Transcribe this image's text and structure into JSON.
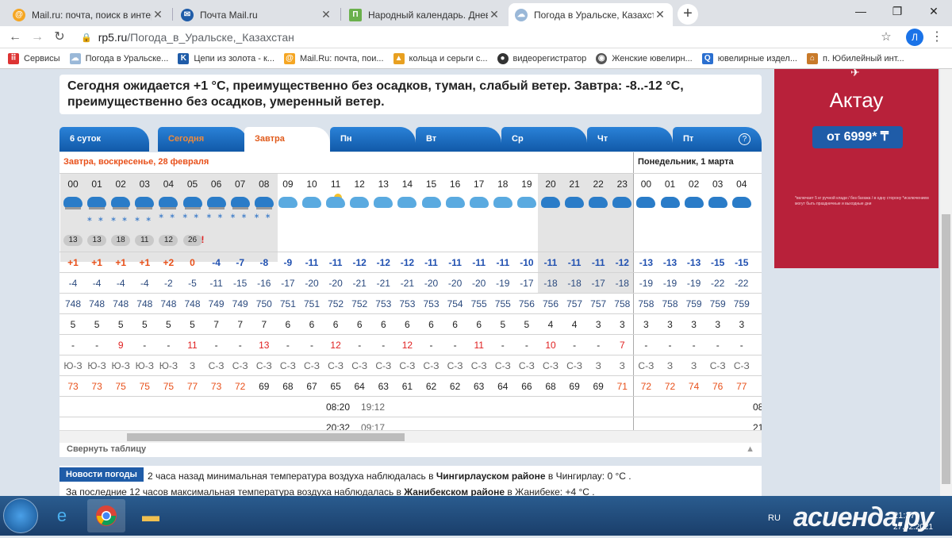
{
  "browser": {
    "tabs": [
      {
        "title": "Mail.ru: почта, поиск в интернете",
        "icon": "mail-ru-icon"
      },
      {
        "title": "Почта Mail.ru",
        "icon": "mail-icon"
      },
      {
        "title": "Народный календарь. Дневник",
        "icon": "calendar-icon"
      },
      {
        "title": "Погода в Уральске, Казахстан -",
        "icon": "weather-icon",
        "active": true
      }
    ],
    "url_host": "rp5.ru",
    "url_path": "/Погода_в_Уральске,_Казахстан",
    "profile_initial": "Л",
    "bookmarks": [
      {
        "label": "Сервисы",
        "icon": "apps-icon"
      },
      {
        "label": "Погода в Уральске...",
        "icon": "weather-icon"
      },
      {
        "label": "Цепи из золота - к...",
        "icon": "chain-icon"
      },
      {
        "label": "Mail.Ru: почта, пои...",
        "icon": "mail-ru-icon"
      },
      {
        "label": "кольца и серьги с...",
        "icon": "ring-icon"
      },
      {
        "label": "видеорегистратор",
        "icon": "camera-icon"
      },
      {
        "label": "Женские ювелирн...",
        "icon": "jewel-icon"
      },
      {
        "label": "ювелирные издел...",
        "icon": "search-icon"
      },
      {
        "label": "п. Юбилейный инт...",
        "icon": "home-icon"
      }
    ]
  },
  "forecast_text": "Сегодня ожидается +1 °C, преимущественно без осадков, туман, слабый ветер. Завтра: -8..-12 °C, преимущественно без осадков, умеренный ветер.",
  "day_tabs": [
    "6 суток",
    "Сегодня",
    "Завтра",
    "Пн",
    "Вт",
    "Ср",
    "Чт",
    "Пт"
  ],
  "help_label": "?",
  "table": {
    "day1_title": "Завтра, воскресенье, 28 февраля",
    "day2_title": "Понедельник, 1 марта",
    "hours": [
      "00",
      "01",
      "02",
      "03",
      "04",
      "05",
      "06",
      "07",
      "08",
      "09",
      "10",
      "11",
      "12",
      "13",
      "14",
      "15",
      "16",
      "17",
      "18",
      "19",
      "20",
      "21",
      "22",
      "23",
      "00",
      "01",
      "02",
      "03",
      "04"
    ],
    "visibility_pills": [
      "13",
      "13",
      "18",
      "11",
      "12",
      "26"
    ],
    "visibility_warn": "!",
    "temp": [
      "+1",
      "+1",
      "+1",
      "+1",
      "+2",
      "0",
      "-4",
      "-7",
      "-8",
      "-9",
      "-11",
      "-11",
      "-12",
      "-12",
      "-12",
      "-11",
      "-11",
      "-11",
      "-11",
      "-10",
      "-11",
      "-11",
      "-11",
      "-12",
      "-13",
      "-13",
      "-13",
      "-15",
      "-15"
    ],
    "feels": [
      "-4",
      "-4",
      "-4",
      "-4",
      "-2",
      "-5",
      "-11",
      "-15",
      "-16",
      "-17",
      "-20",
      "-20",
      "-21",
      "-21",
      "-21",
      "-20",
      "-20",
      "-20",
      "-19",
      "-17",
      "-18",
      "-18",
      "-17",
      "-18",
      "-19",
      "-19",
      "-19",
      "-22",
      "-22"
    ],
    "pressure": [
      "748",
      "748",
      "748",
      "748",
      "748",
      "748",
      "749",
      "749",
      "750",
      "751",
      "751",
      "752",
      "752",
      "753",
      "753",
      "753",
      "754",
      "755",
      "755",
      "756",
      "756",
      "757",
      "757",
      "758",
      "758",
      "758",
      "759",
      "759",
      "759"
    ],
    "wind": [
      "5",
      "5",
      "5",
      "5",
      "5",
      "5",
      "7",
      "7",
      "7",
      "6",
      "6",
      "6",
      "6",
      "6",
      "6",
      "6",
      "6",
      "6",
      "5",
      "5",
      "4",
      "4",
      "3",
      "3",
      "3",
      "3",
      "3",
      "3",
      "3"
    ],
    "gusts": [
      "-",
      "-",
      "9",
      "-",
      "-",
      "11",
      "-",
      "-",
      "13",
      "-",
      "-",
      "12",
      "-",
      "-",
      "12",
      "-",
      "-",
      "11",
      "-",
      "-",
      "10",
      "-",
      "-",
      "7",
      "-",
      "-",
      "-",
      "-",
      "-"
    ],
    "direction": [
      "Ю-З",
      "Ю-З",
      "Ю-З",
      "Ю-З",
      "Ю-З",
      "З",
      "С-З",
      "С-З",
      "С-З",
      "С-З",
      "С-З",
      "С-З",
      "С-З",
      "С-З",
      "С-З",
      "С-З",
      "С-З",
      "С-З",
      "С-З",
      "С-З",
      "С-З",
      "С-З",
      "З",
      "З",
      "С-З",
      "З",
      "З",
      "С-З",
      "С-З"
    ],
    "humidity": [
      "73",
      "73",
      "75",
      "75",
      "75",
      "77",
      "73",
      "72",
      "69",
      "68",
      "67",
      "65",
      "64",
      "63",
      "61",
      "62",
      "62",
      "63",
      "64",
      "66",
      "68",
      "69",
      "69",
      "71",
      "72",
      "72",
      "74",
      "76",
      "77"
    ],
    "sunrise": "08:20",
    "sunset": "19:12",
    "moonrise": "20:32",
    "moonset": "09:17",
    "next_sun_partial": "08",
    "next_moon_partial": "21"
  },
  "collapse_label": "Свернуть таблицу",
  "news": {
    "badge": "Новости погоды",
    "line1_a": "2 часа назад минимальная температура воздуха наблюдалась в",
    "line1_b": "Чингирлауском районе",
    "line1_c": "в Чингирлау: 0 °С .",
    "line2_a": "За последние 12 часов максимальная температура воздуха наблюдалась в",
    "line2_b": "Жанибекском районе",
    "line2_c": "в Жанибеке: +4 °С ."
  },
  "ad": {
    "city": "Актау",
    "price": "от 6999* ₸",
    "fine": "*включает 5 кг ручной клади / без багажа / в одну сторону *исключением могут быть праздничные и выходные дни"
  },
  "taskbar": {
    "lang": "RU",
    "time": "21:37",
    "date": "27.02.2021",
    "watermark": "асиенда.ру"
  },
  "colors": {
    "tab_blue": "#1b6cc2",
    "warm": "#e8501a",
    "cold": "#2050b0",
    "ad_bg": "#b8213a"
  }
}
